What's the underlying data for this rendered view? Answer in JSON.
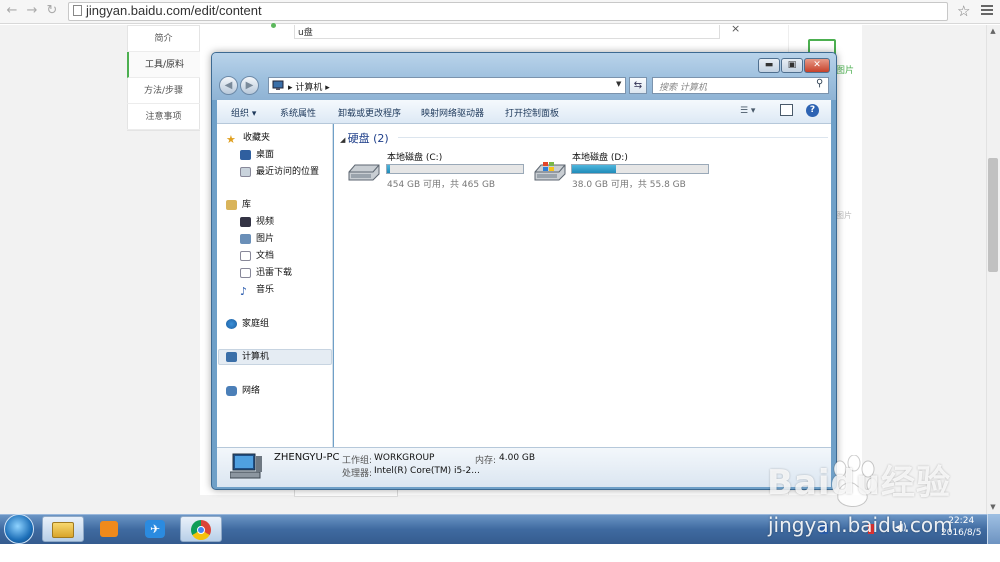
{
  "browser": {
    "url": "jingyan.baidu.com/edit/content"
  },
  "page": {
    "leftnav": [
      "简介",
      "工具/原料",
      "方法/步骤",
      "注意事项"
    ],
    "input_value": "u盘",
    "close_symbol": "×",
    "side_label": "图片",
    "side_label2": "图片"
  },
  "explorer": {
    "breadcrumb": "计算机",
    "search_placeholder": "搜索 计算机",
    "commands": [
      "组织 ▾",
      "系统属性",
      "卸载或更改程序",
      "映射网络驱动器",
      "打开控制面板"
    ],
    "nav": {
      "favorites": "收藏夹",
      "desktop": "桌面",
      "recent": "最近访问的位置",
      "libraries": "库",
      "videos": "视频",
      "pictures": "图片",
      "documents": "文档",
      "thunder": "迅雷下载",
      "music": "音乐",
      "homegroup": "家庭组",
      "computer": "计算机",
      "network": "网络"
    },
    "group_header": "硬盘 (2)",
    "drives": [
      {
        "name": "本地磁盘 (C:)",
        "info": "454 GB 可用，共 465 GB",
        "used_fraction": 0.024
      },
      {
        "name": "本地磁盘 (D:)",
        "info": "38.0 GB 可用，共 55.8 GB",
        "used_fraction": 0.32
      }
    ],
    "details": {
      "pc_name": "ZHENGYU-PC",
      "workgroup_label": "工作组:",
      "workgroup": "WORKGROUP",
      "memory_label": "内存:",
      "memory": "4.00 GB",
      "cpu_label": "处理器:",
      "cpu": "Intel(R) Core(TM) i5-2..."
    }
  },
  "taskbar": {
    "time": "22:24",
    "date": "2016/8/5"
  },
  "watermark": {
    "brand": "Baidu经验",
    "site": "jingyan.baidu.com"
  },
  "colors": {
    "accent_green": "#4caf50",
    "window_frame": "#6fa0c8",
    "drive_bar": "#1f8bb9"
  }
}
